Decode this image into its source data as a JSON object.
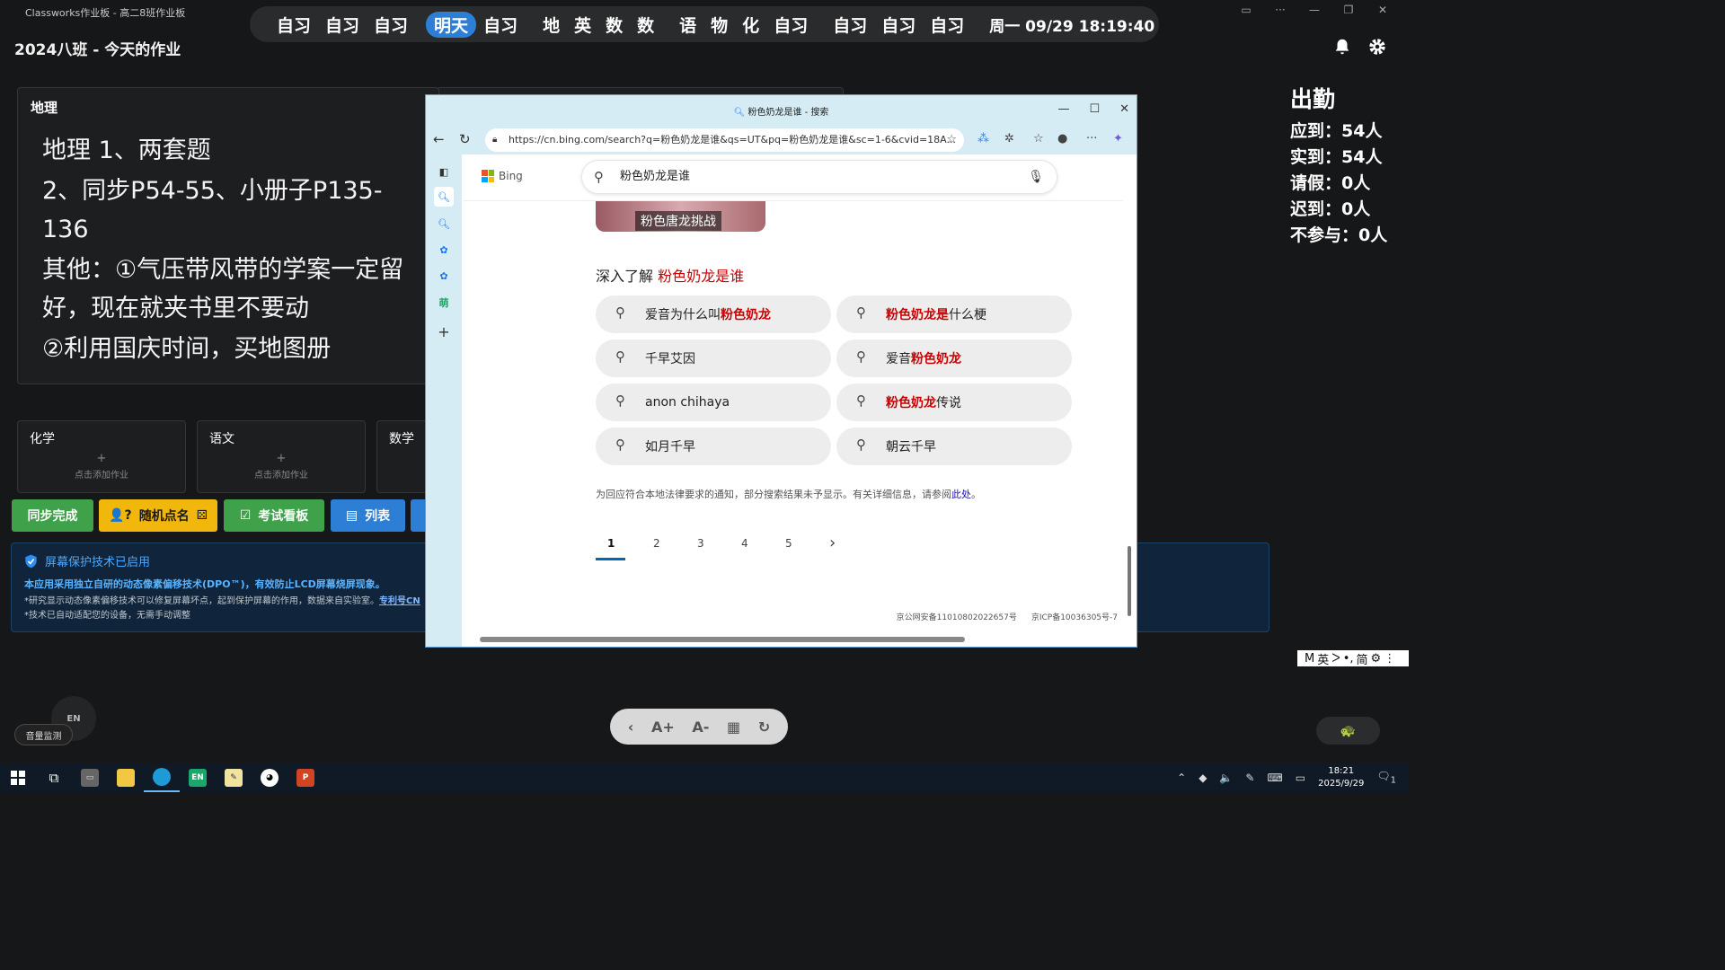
{
  "app": {
    "title": "Classworks作业板 - 高二8班作业板",
    "board_title": "2024八班 - 今天的作业"
  },
  "schedule": {
    "groups": [
      [
        "自习",
        "自习",
        "自习"
      ],
      [
        "明天",
        "自习"
      ],
      [
        "地",
        "英",
        "数",
        "数"
      ],
      [
        "语",
        "物",
        "化",
        "自习"
      ],
      [
        "自习",
        "自习",
        "自习"
      ]
    ],
    "active": "明天",
    "datetime": "周一 09/29  18:19:40",
    "accent": "#2d7fd6"
  },
  "geography": {
    "subject": "地理",
    "lines": [
      "地理 1、两套题",
      "2、同步P54-55、小册子P135-136",
      "其他：①气压带风带的学案一定留好，现在就夹书里不要动",
      "②利用国庆时间，买地图册"
    ]
  },
  "small_cards": [
    {
      "subject": "化学",
      "plus": "+",
      "add": "点击添加作业"
    },
    {
      "subject": "语文",
      "plus": "+",
      "add": "点击添加作业"
    },
    {
      "subject": "数学"
    }
  ],
  "buttons": {
    "sync": "同步完成",
    "random": "随机点名",
    "exam": "考试看板",
    "list": "列表"
  },
  "info": {
    "title": "屏幕保护技术已启用",
    "line1": "本应用采用独立自研的动态像素偏移技术(DPO™)，有效防止LCD屏幕烧屏现象。",
    "line2": "*研究显示动态像素偏移技术可以修复屏幕坏点，起到保护屏幕的作用，数据来自实验室。",
    "line2_link": "专利号CN",
    "line3": "*技术已自动适配您的设备，无需手动调整"
  },
  "attendance": {
    "title": "出勤",
    "expected": "应到：54人",
    "actual": "实到：54人",
    "leave": "请假：0人",
    "late": "迟到：0人",
    "absent": "不参与：0人"
  },
  "bottom": {
    "volume": "音量监测",
    "en": "EN"
  },
  "ime": {
    "items": [
      "M",
      "英",
      "ᐳ",
      "•,",
      "简",
      "⚙",
      "⋮"
    ]
  },
  "taskbar": {
    "time": "18:21",
    "date": "2025/9/29",
    "notif_count": "1"
  },
  "browser": {
    "tab_title": "粉色奶龙是谁 - 搜索",
    "url": "https://cn.bing.com/search?q=粉色奶龙是谁&qs=UT&pq=粉色奶龙是谁&sc=1-6&cvid=18A...",
    "bing": "Bing",
    "query": "粉色奶龙是谁",
    "thumb_caption": "粉色唐龙挑战",
    "deep_prefix": "深入了解 ",
    "deep_query": "粉色奶龙是谁",
    "suggestions": [
      {
        "pre": "爱音为什么叫",
        "hl": "粉色奶龙",
        "post": ""
      },
      {
        "pre": "",
        "hl": "粉色奶龙是",
        "post": "什么梗"
      },
      {
        "pre": "千早艾因",
        "hl": "",
        "post": ""
      },
      {
        "pre": "爱音",
        "hl": "粉色奶龙",
        "post": ""
      },
      {
        "pre": "anon chihaya",
        "hl": "",
        "post": ""
      },
      {
        "pre": "",
        "hl": "粉色奶龙",
        "post": "传说"
      },
      {
        "pre": "如月千早",
        "hl": "",
        "post": ""
      },
      {
        "pre": "朝云千早",
        "hl": "",
        "post": ""
      }
    ],
    "notice": "为回应符合本地法律要求的通知，部分搜索结果未予显示。有关详细信息，请参阅",
    "notice_link": "此处",
    "notice_end": "。",
    "pages": [
      "1",
      "2",
      "3",
      "4",
      "5"
    ],
    "footer1": "京公网安备11010802022657号",
    "footer2": "京ICP备10036305号-7"
  }
}
